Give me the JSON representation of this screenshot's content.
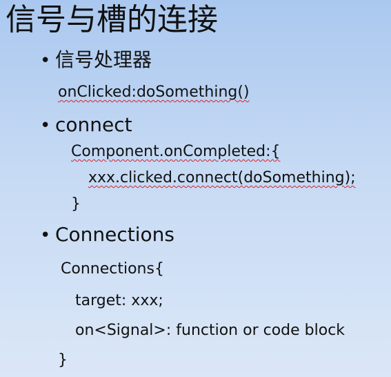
{
  "slide": {
    "title": "信号与槽的连接",
    "bullets": [
      {
        "marker": "•",
        "text": "信号处理器"
      },
      {
        "marker": "•",
        "text": "connect"
      },
      {
        "marker": "•",
        "text": "Connections"
      }
    ],
    "code": {
      "handler_line": "onClicked:doSomething()",
      "connect_line1": "Component.onCompleted:{",
      "connect_line2": "xxx.clicked.connect(doSomething);",
      "connect_line3": "}",
      "connections_line1": "Connections{",
      "connections_line2": "target: xxx;",
      "connections_line3": "on<Signal>: function or code block",
      "connections_line4": "}"
    }
  }
}
